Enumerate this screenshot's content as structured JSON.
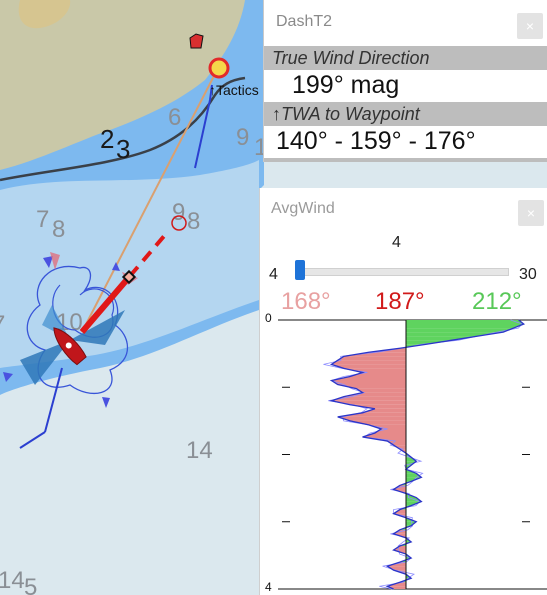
{
  "map": {
    "depths_dark": [
      "2",
      "3"
    ],
    "depths": [
      "6",
      "9",
      "1",
      "7",
      "8",
      "9",
      "8",
      "7",
      "10",
      "14",
      "14",
      "5"
    ],
    "waypoint_label": "Tactics",
    "colors": {
      "land": "#c9c8a8",
      "shallow": "#7db9ef",
      "mid": "#b4d6f0",
      "deep": "#dbe8ee",
      "boat": "#c0161b"
    }
  },
  "dasht2": {
    "title": "DashT2",
    "close_label": "×",
    "twd_label": "True Wind Direction",
    "twd_value": "199° mag",
    "twa_label": "↑TWA to Waypoint",
    "twa_value": "140° - 159° - 176°"
  },
  "avgwind": {
    "title": "AvgWind",
    "close_label": "×",
    "slider_value": "4",
    "slider_min": "4",
    "slider_max": "30",
    "slider_fraction": 0.0,
    "deg_left": "168°",
    "deg_center": "187°",
    "deg_right": "212°",
    "axis_top": "0",
    "axis_bottom": "4"
  },
  "wind_history": {
    "center_deg": 187,
    "min_deg": 168,
    "max_deg": 212,
    "y_range": [
      0,
      4
    ],
    "samples": [
      {
        "t": 0.0,
        "deg": 209
      },
      {
        "t": 0.06,
        "deg": 210
      },
      {
        "t": 0.12,
        "deg": 208
      },
      {
        "t": 0.18,
        "deg": 206
      },
      {
        "t": 0.24,
        "deg": 201
      },
      {
        "t": 0.3,
        "deg": 196
      },
      {
        "t": 0.36,
        "deg": 191
      },
      {
        "t": 0.42,
        "deg": 186
      },
      {
        "t": 0.48,
        "deg": 181
      },
      {
        "t": 0.54,
        "deg": 177
      },
      {
        "t": 0.6,
        "deg": 176
      },
      {
        "t": 0.66,
        "deg": 175
      },
      {
        "t": 0.72,
        "deg": 177
      },
      {
        "t": 0.78,
        "deg": 180
      },
      {
        "t": 0.84,
        "deg": 178
      },
      {
        "t": 0.9,
        "deg": 175
      },
      {
        "t": 0.96,
        "deg": 176
      },
      {
        "t": 1.02,
        "deg": 179
      },
      {
        "t": 1.08,
        "deg": 180
      },
      {
        "t": 1.14,
        "deg": 177
      },
      {
        "t": 1.2,
        "deg": 175
      },
      {
        "t": 1.26,
        "deg": 178
      },
      {
        "t": 1.32,
        "deg": 182
      },
      {
        "t": 1.38,
        "deg": 180
      },
      {
        "t": 1.44,
        "deg": 176
      },
      {
        "t": 1.5,
        "deg": 178
      },
      {
        "t": 1.56,
        "deg": 181
      },
      {
        "t": 1.62,
        "deg": 183
      },
      {
        "t": 1.68,
        "deg": 182
      },
      {
        "t": 1.74,
        "deg": 180
      },
      {
        "t": 1.8,
        "deg": 184
      },
      {
        "t": 1.86,
        "deg": 185
      },
      {
        "t": 1.92,
        "deg": 186
      },
      {
        "t": 1.98,
        "deg": 187
      },
      {
        "t": 2.04,
        "deg": 188
      },
      {
        "t": 2.1,
        "deg": 189
      },
      {
        "t": 2.16,
        "deg": 188
      },
      {
        "t": 2.22,
        "deg": 187
      },
      {
        "t": 2.28,
        "deg": 189
      },
      {
        "t": 2.34,
        "deg": 190
      },
      {
        "t": 2.4,
        "deg": 188
      },
      {
        "t": 2.46,
        "deg": 186
      },
      {
        "t": 2.52,
        "deg": 185
      },
      {
        "t": 2.58,
        "deg": 187
      },
      {
        "t": 2.64,
        "deg": 189
      },
      {
        "t": 2.7,
        "deg": 190
      },
      {
        "t": 2.76,
        "deg": 188
      },
      {
        "t": 2.82,
        "deg": 186
      },
      {
        "t": 2.88,
        "deg": 185
      },
      {
        "t": 2.94,
        "deg": 187
      },
      {
        "t": 3.0,
        "deg": 189
      },
      {
        "t": 3.06,
        "deg": 188
      },
      {
        "t": 3.12,
        "deg": 186
      },
      {
        "t": 3.18,
        "deg": 185
      },
      {
        "t": 3.24,
        "deg": 187
      },
      {
        "t": 3.3,
        "deg": 188
      },
      {
        "t": 3.36,
        "deg": 186
      },
      {
        "t": 3.42,
        "deg": 185
      },
      {
        "t": 3.48,
        "deg": 187
      },
      {
        "t": 3.54,
        "deg": 188
      },
      {
        "t": 3.6,
        "deg": 186
      },
      {
        "t": 3.66,
        "deg": 184
      },
      {
        "t": 3.72,
        "deg": 185
      },
      {
        "t": 3.78,
        "deg": 187
      },
      {
        "t": 3.84,
        "deg": 188
      },
      {
        "t": 3.9,
        "deg": 186
      },
      {
        "t": 3.96,
        "deg": 184
      },
      {
        "t": 4.0,
        "deg": 185
      }
    ]
  }
}
